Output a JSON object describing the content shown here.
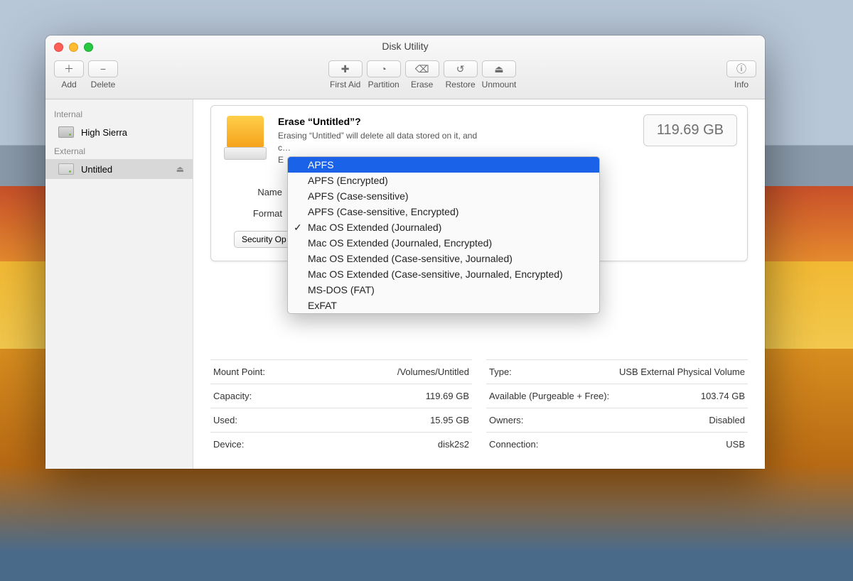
{
  "window": {
    "title": "Disk Utility",
    "toolbar": {
      "add": "Add",
      "delete": "Delete",
      "first_aid": "First Aid",
      "partition": "Partition",
      "erase": "Erase",
      "restore": "Restore",
      "unmount": "Unmount",
      "info": "Info"
    }
  },
  "sidebar": {
    "section_internal": "Internal",
    "internal_items": [
      {
        "label": "High Sierra"
      }
    ],
    "section_external": "External",
    "external_items": [
      {
        "label": "Untitled",
        "ejectable": true,
        "selected": true
      }
    ]
  },
  "sheet": {
    "heading": "Erase “Untitled”?",
    "description": "Erasing “Untitled” will delete all data stored on it, and",
    "description2_prefix": "E",
    "name_label": "Name",
    "format_label": "Format",
    "security_button": "Security Op",
    "capacity_badge": "119.69 GB"
  },
  "format_menu": {
    "highlighted_index": 0,
    "checked_index": 4,
    "options": [
      "APFS",
      "APFS (Encrypted)",
      "APFS (Case-sensitive)",
      "APFS (Case-sensitive, Encrypted)",
      "Mac OS Extended (Journaled)",
      "Mac OS Extended (Journaled, Encrypted)",
      "Mac OS Extended (Case-sensitive, Journaled)",
      "Mac OS Extended (Case-sensitive, Journaled, Encrypted)",
      "MS-DOS (FAT)",
      "ExFAT"
    ]
  },
  "details": {
    "left": [
      {
        "label": "Mount Point:",
        "value": "/Volumes/Untitled"
      },
      {
        "label": "Capacity:",
        "value": "119.69 GB"
      },
      {
        "label": "Used:",
        "value": "15.95 GB"
      },
      {
        "label": "Device:",
        "value": "disk2s2"
      }
    ],
    "right": [
      {
        "label": "Type:",
        "value": "USB External Physical Volume"
      },
      {
        "label": "Available (Purgeable + Free):",
        "value": "103.74 GB"
      },
      {
        "label": "Owners:",
        "value": "Disabled"
      },
      {
        "label": "Connection:",
        "value": "USB"
      }
    ]
  }
}
